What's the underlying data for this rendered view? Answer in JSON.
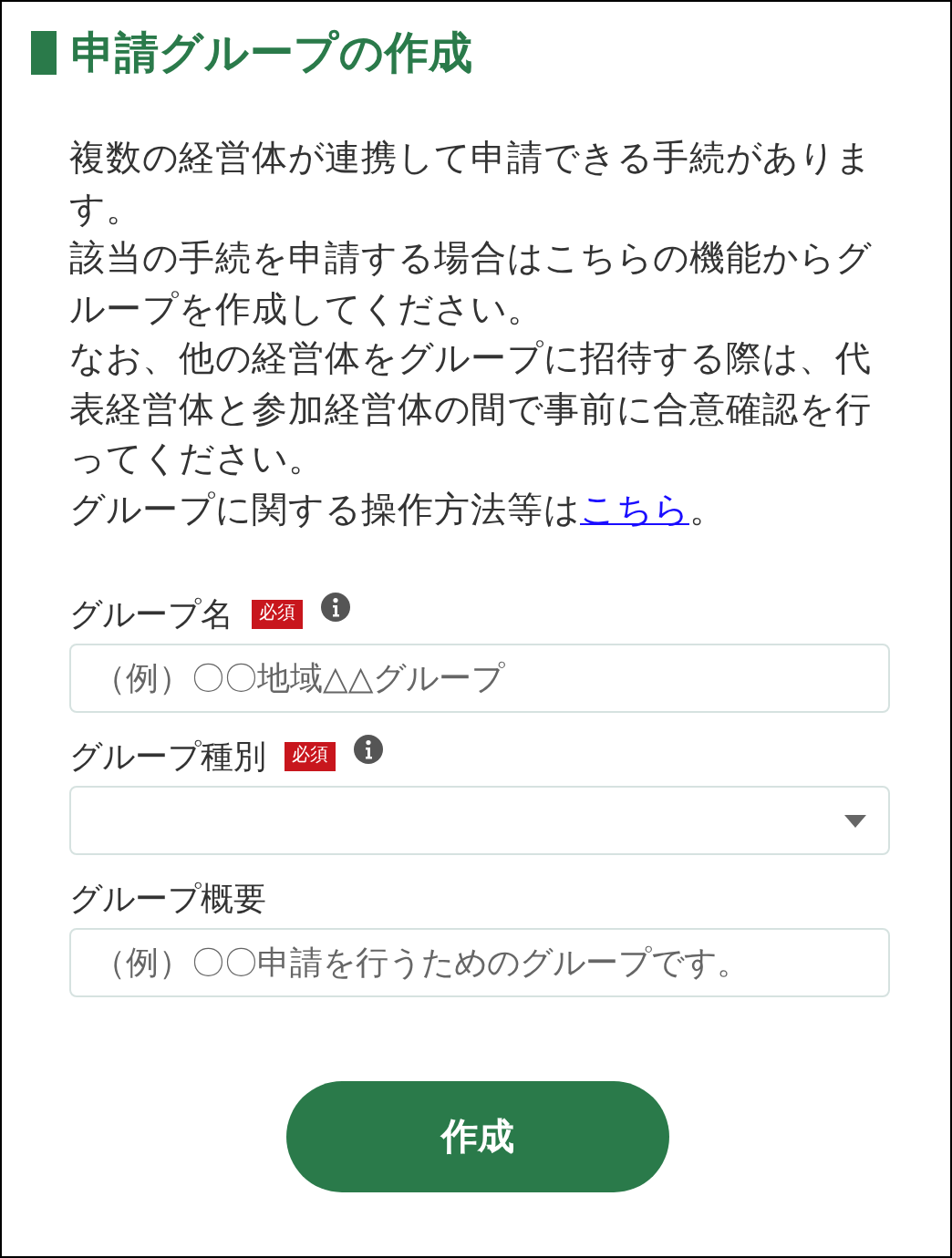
{
  "title": "申請グループの作成",
  "intro": [
    "複数の経営体が連携して申請できる手続があります。",
    "該当の手続を申請する場合はこちらの機能からグループを作成してください。",
    "なお、他の経営体をグループに招待する際は、代表経営体と参加経営体の間で事前に合意確認を行ってください。"
  ],
  "help": {
    "before": "グループに関する操作方法等は",
    "link": "こちら",
    "after": "。"
  },
  "fields": [
    {
      "kind": "text",
      "label": "グループ名",
      "required": true,
      "badge": "必須",
      "info": true,
      "placeholder": "（例）〇〇地域△△グループ"
    },
    {
      "kind": "select",
      "label": "グループ種別",
      "required": true,
      "badge": "必須",
      "info": true
    },
    {
      "kind": "text",
      "label": "グループ概要",
      "required": false,
      "info": false,
      "placeholder": "（例）〇〇申請を行うためのグループです。"
    }
  ],
  "submit": "作成"
}
